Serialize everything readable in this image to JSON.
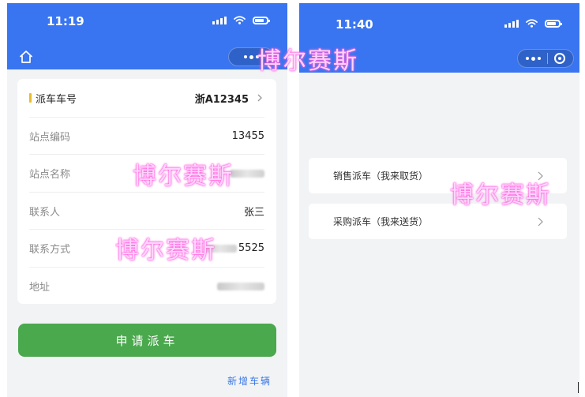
{
  "left": {
    "status_bar": {
      "time": "11:19"
    },
    "form": {
      "rows": [
        {
          "label": "派车车号",
          "value": "浙A12345"
        },
        {
          "label": "站点编码",
          "value": "13455"
        },
        {
          "label": "站点名称",
          "value": ""
        },
        {
          "label": "联系人",
          "value": "张三"
        },
        {
          "label": "联系方式",
          "value": "5525"
        },
        {
          "label": "地址",
          "value": ""
        }
      ]
    },
    "apply_button": "申请派车",
    "new_vehicle_link": "新增车辆"
  },
  "right": {
    "status_bar": {
      "time": "11:40"
    },
    "menu": [
      {
        "label": "销售派车（我来取货）"
      },
      {
        "label": "采购派车（我来送货）"
      }
    ]
  },
  "watermark": "博尔赛斯",
  "colors": {
    "brand_blue": "#3975f0",
    "button_green": "#4aa84d",
    "link_blue": "#3a78e3",
    "accent_yellow": "#e8bc2c"
  }
}
